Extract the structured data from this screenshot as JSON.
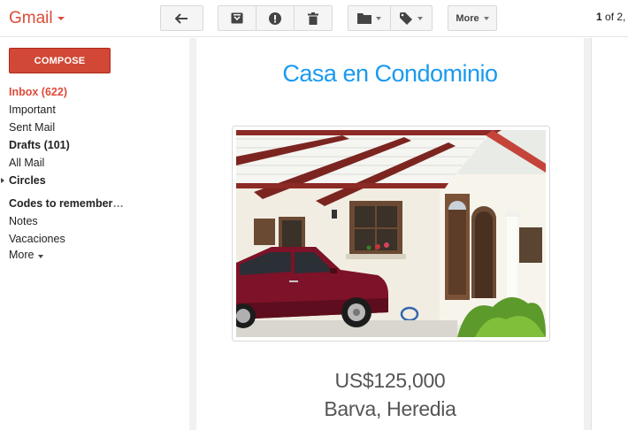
{
  "app": {
    "name": "Gmail",
    "accent": "#dd4b39"
  },
  "toolbar": {
    "reply_icon": "reply-arrow-icon",
    "archive_icon": "archive-icon",
    "spam_icon": "report-spam-icon",
    "delete_icon": "trash-icon",
    "move_icon": "folder-icon",
    "labels_icon": "label-tag-icon",
    "more_label": "More"
  },
  "pager": {
    "current": "1",
    "rest": " of 2,"
  },
  "sidebar": {
    "compose_label": "COMPOSE",
    "compose_color": "#d14836",
    "items": [
      {
        "label": "Inbox (622)"
      },
      {
        "label": "Important"
      },
      {
        "label": "Sent Mail"
      },
      {
        "label": "Drafts (101)"
      },
      {
        "label": "All Mail"
      },
      {
        "label": "Circles"
      },
      {
        "label": "Codes to remember"
      },
      {
        "label": "Notes"
      },
      {
        "label": "Vacaciones"
      },
      {
        "label": "More"
      }
    ],
    "ellipsis": "…"
  },
  "email": {
    "title": "Casa en Condominio",
    "title_color": "#1a9af0",
    "photo": "photo of a white house with brown window frames and a red car parked under a carport",
    "price": "US$125,000",
    "location": "Barva, Heredia"
  }
}
